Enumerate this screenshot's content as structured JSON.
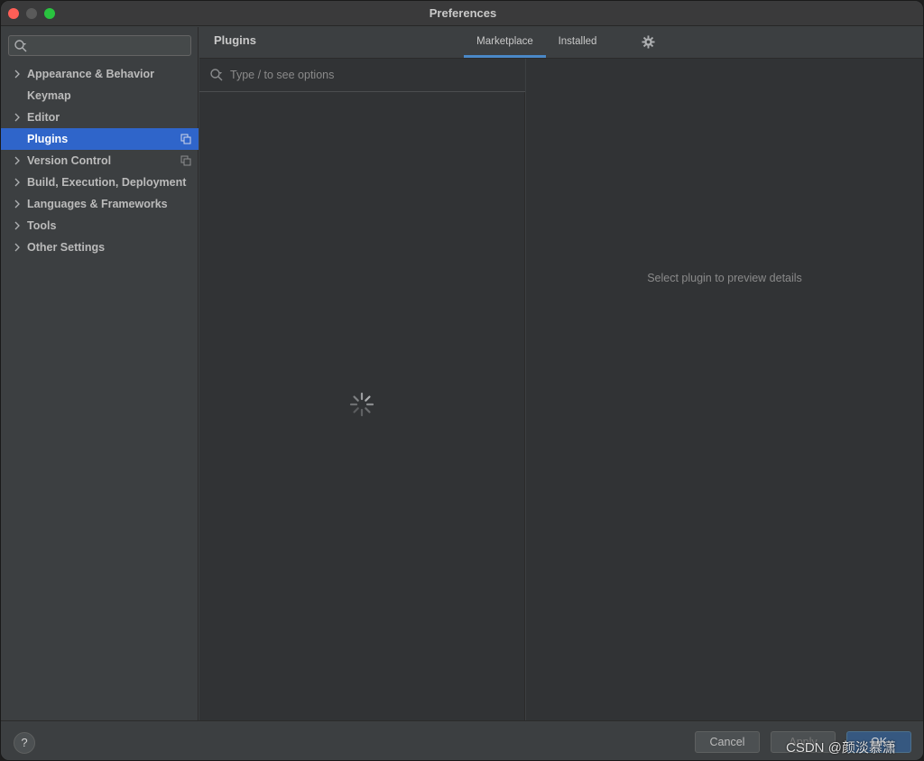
{
  "window": {
    "title": "Preferences",
    "traffic_lights": {
      "close_color": "#fe5f57",
      "minimize_color": "#5a5a5a",
      "maximize_color": "#29c33f"
    }
  },
  "sidebar": {
    "search": {
      "value": "",
      "icon": "search-icon"
    },
    "items": [
      {
        "label": "Appearance & Behavior",
        "expandable": true
      },
      {
        "label": "Keymap",
        "expandable": false
      },
      {
        "label": "Editor",
        "expandable": true
      },
      {
        "label": "Plugins",
        "expandable": false,
        "selected": true,
        "copy_icon": true
      },
      {
        "label": "Version Control",
        "expandable": true,
        "copy_icon": true
      },
      {
        "label": "Build, Execution, Deployment",
        "expandable": true
      },
      {
        "label": "Languages & Frameworks",
        "expandable": true
      },
      {
        "label": "Tools",
        "expandable": true
      },
      {
        "label": "Other Settings",
        "expandable": true
      }
    ],
    "selected_color": "#2f65ca"
  },
  "header": {
    "title": "Plugins",
    "tabs": [
      {
        "label": "Marketplace",
        "active": true
      },
      {
        "label": "Installed",
        "active": false
      }
    ],
    "settings_icon": "gear-icon",
    "active_tab_color": "#4a88c7"
  },
  "plugin_list": {
    "search": {
      "placeholder": "Type / to see options",
      "value": ""
    },
    "loading": true
  },
  "details": {
    "placeholder": "Select plugin to preview details"
  },
  "footer": {
    "help_label": "?",
    "cancel_label": "Cancel",
    "apply_label": "Apply",
    "ok_label": "OK",
    "watermark": "CSDN @颜淡慕潇"
  }
}
